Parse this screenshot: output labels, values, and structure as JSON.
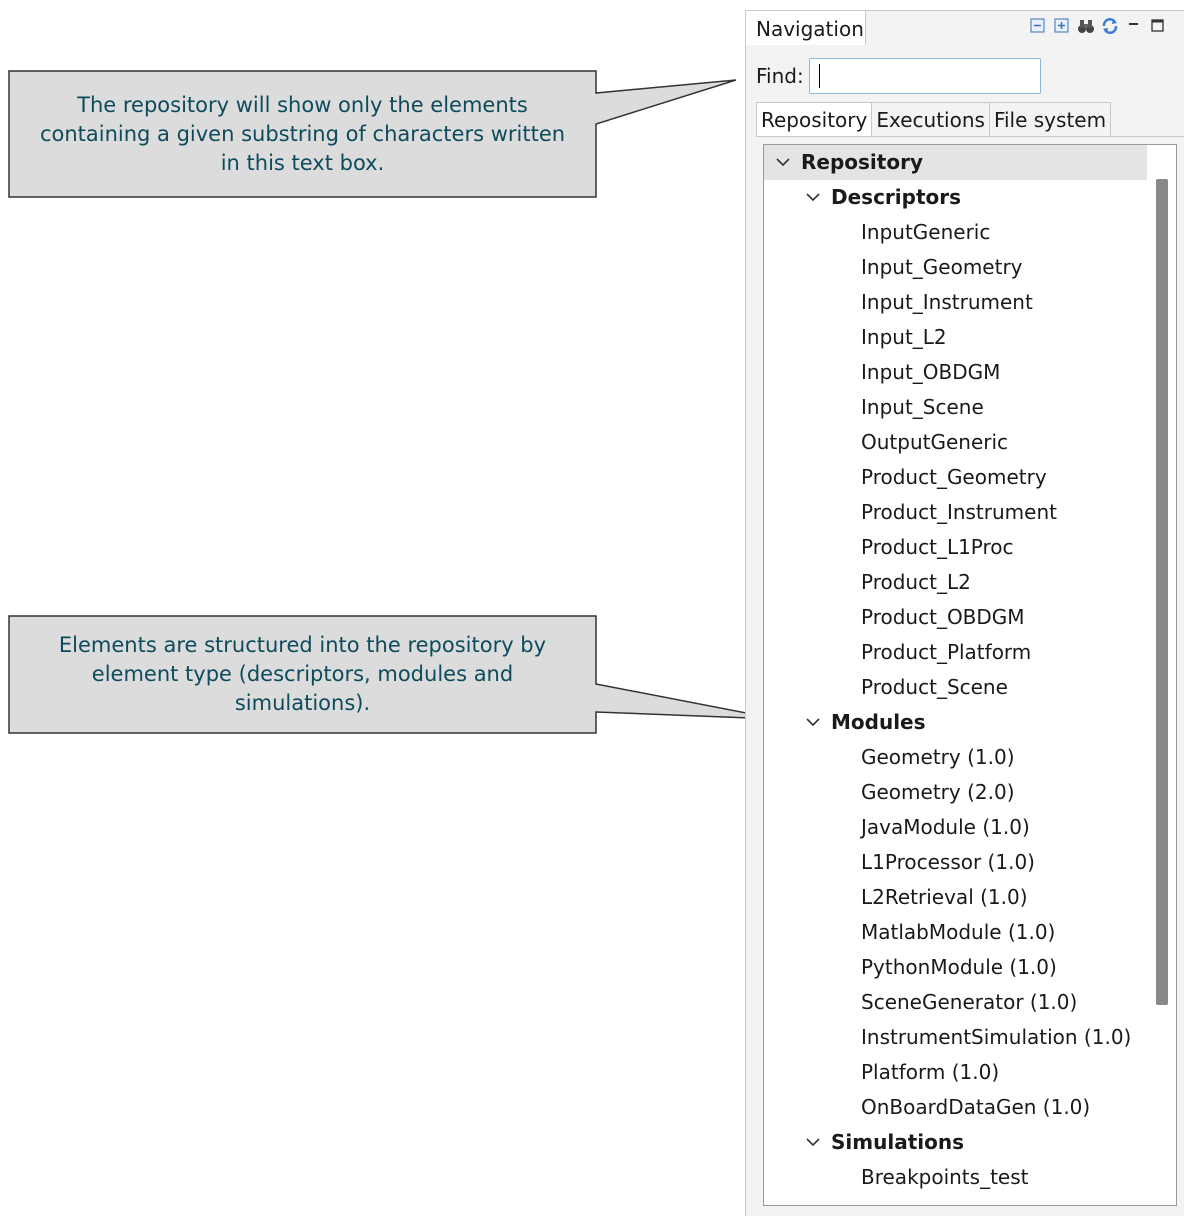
{
  "callouts": [
    {
      "text": "The repository will show only the elements containing a given substring of characters written in this text box."
    },
    {
      "text": "Elements are structured into the repository by element type (descriptors, modules and simulations)."
    }
  ],
  "colors": {
    "callout_fill": "#dcdcdc",
    "callout_text": "#0d4b5c",
    "selection": "#e4e4e4"
  },
  "panel": {
    "title": "Navigation",
    "toolbar_icons": [
      "collapse-all-icon",
      "expand-all-icon",
      "binoculars-icon",
      "refresh-icon",
      "minimize-icon",
      "maximize-icon"
    ],
    "find_label": "Find:",
    "find_value": "",
    "tabs": [
      "Repository",
      "Executions",
      "File system"
    ],
    "tree": {
      "root": "Repository",
      "descriptors_label": "Descriptors",
      "descriptors": [
        "InputGeneric",
        "Input_Geometry",
        "Input_Instrument",
        "Input_L2",
        "Input_OBDGM",
        "Input_Scene",
        "OutputGeneric",
        "Product_Geometry",
        "Product_Instrument",
        "Product_L1Proc",
        "Product_L2",
        "Product_OBDGM",
        "Product_Platform",
        "Product_Scene"
      ],
      "modules_label": "Modules",
      "modules": [
        "Geometry (1.0)",
        "Geometry (2.0)",
        "JavaModule (1.0)",
        "L1Processor (1.0)",
        "L2Retrieval (1.0)",
        "MatlabModule (1.0)",
        "PythonModule (1.0)",
        "SceneGenerator (1.0)",
        "InstrumentSimulation (1.0)",
        "Platform (1.0)",
        "OnBoardDataGen (1.0)"
      ],
      "simulations_label": "Simulations",
      "simulations": [
        "Breakpoints_test"
      ]
    }
  }
}
